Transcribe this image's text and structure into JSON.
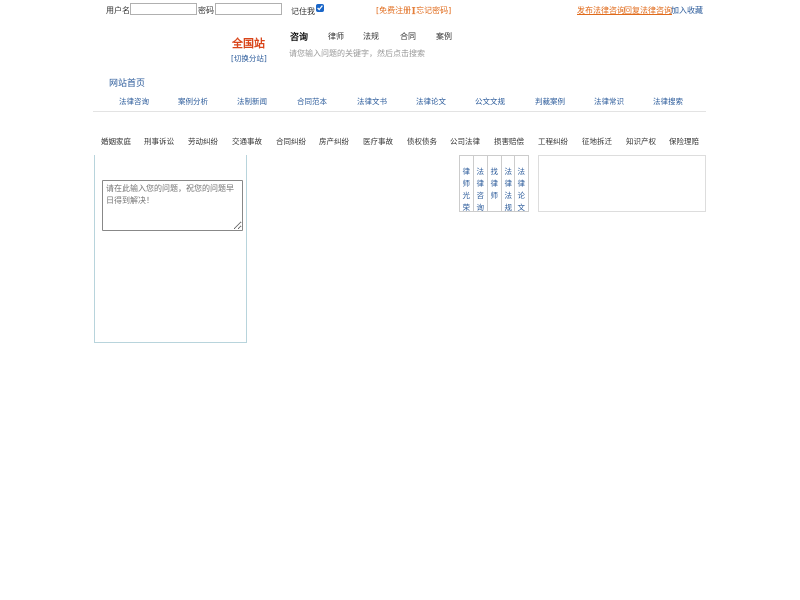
{
  "login": {
    "username_label": "用户名",
    "password_label": "密码",
    "remember_label": "记住我",
    "register_link": "[免费注册]",
    "forgot_link": "[忘记密码]",
    "username_value": "",
    "password_value": ""
  },
  "top_links": {
    "publish": "发布法律咨询",
    "answer": "回复法律咨询",
    "favorite": "加入收藏"
  },
  "station": {
    "title": "全国站",
    "switch": "[切换分站]"
  },
  "search": {
    "tabs": [
      "咨询",
      "律师",
      "法规",
      "合同",
      "案例"
    ],
    "hint": "请您输入问题的关键字，然后点击搜索"
  },
  "home_link": "网站首页",
  "nav": [
    "法律咨询",
    "案例分析",
    "法制新闻",
    "合同范本",
    "法律文书",
    "法律论文",
    "公文文规",
    "判裁案例",
    "法律常识",
    "法律搜索"
  ],
  "categories": [
    "婚姻家庭",
    "刑事诉讼",
    "劳动纠纷",
    "交通事故",
    "合同纠纷",
    "房产纠纷",
    "医疗事故",
    "债权债务",
    "公司法律",
    "损害赔偿",
    "工程纠纷",
    "征地拆迁",
    "知识产权",
    "保险理赔"
  ],
  "question": {
    "placeholder": "请在此输入您的问题，祝您的问题早日得到解决！"
  },
  "vertical_tabs": [
    "律师光荣榜",
    "法律咨询",
    "找律师",
    "法律法规",
    "法律论文"
  ],
  "colors": {
    "brand_red": "#d9451a",
    "link_orange": "#e06a1a",
    "link_blue": "#2a5a9a"
  }
}
